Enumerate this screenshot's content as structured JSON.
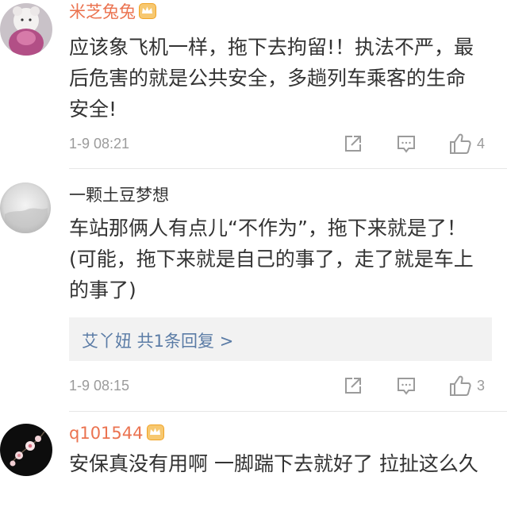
{
  "comments": [
    {
      "username": "米芝兔兔",
      "text": "应该象飞机一样，拖下去拘留!！执法不严，最后危害的就是公共安全，多趟列车乘客的生命安全!",
      "time": "1-9 08:21",
      "likes": "4",
      "vip": true
    },
    {
      "username": "一颗土豆梦想",
      "text": "车站那俩人有点儿“不作为”，拖下来就是了！(可能，拖下来就是自己的事了，走了就是车上的事了)",
      "reply_summary": "艾丫妞  共1条回复 >",
      "time": "1-9 08:15",
      "likes": "3",
      "vip": false
    },
    {
      "username": "q101544",
      "text": "安保真没有用啊 一脚踹下去就好了 拉扯这么久",
      "vip": true
    }
  ],
  "icons": {
    "share": "share-icon",
    "comment": "comment-icon",
    "like": "thumbs-up-icon"
  },
  "colors": {
    "username_orange": "#eb7350",
    "link_blue": "#5b7ca6",
    "meta_gray": "#9b9b9b"
  }
}
